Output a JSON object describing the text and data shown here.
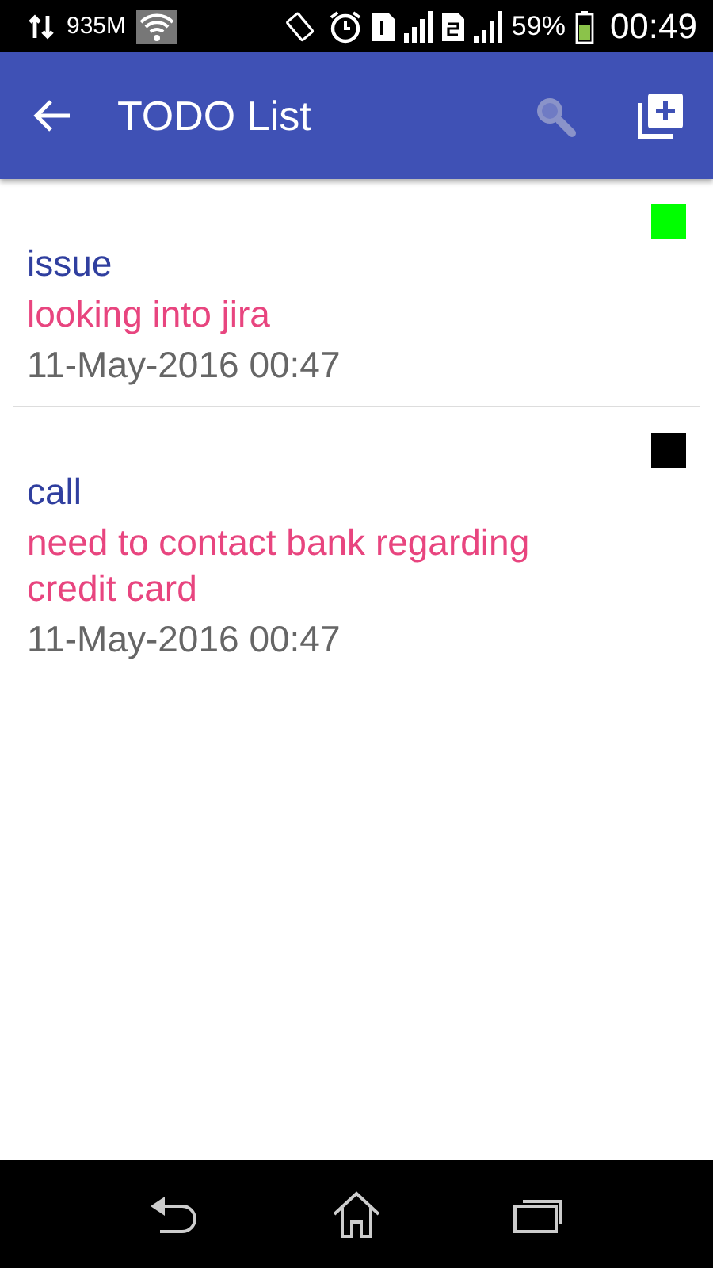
{
  "status_bar": {
    "data_usage": "935M",
    "battery": "59%",
    "time": "00:49"
  },
  "app_bar": {
    "title": "TODO List"
  },
  "todos": [
    {
      "title": "issue",
      "description": "looking into jira",
      "date": "11-May-2016 00:47",
      "color": "#00ff00"
    },
    {
      "title": "call",
      "description": "need to contact bank regarding credit card",
      "date": "11-May-2016 00:47",
      "color": "#000000"
    }
  ]
}
